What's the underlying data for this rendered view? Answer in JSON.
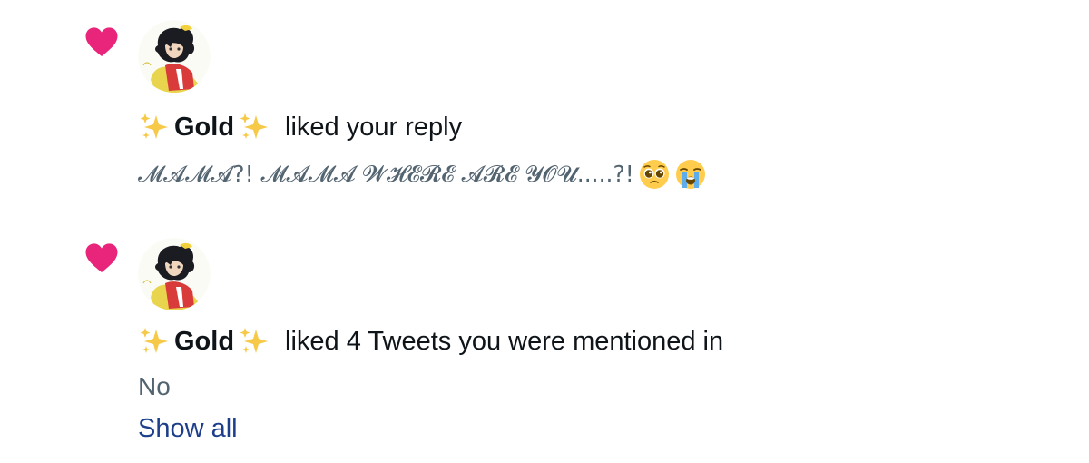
{
  "notifications": [
    {
      "type": "like",
      "icon": "heart-icon",
      "icon_color": "#e8257a",
      "username": "Gold",
      "action": "liked your reply",
      "tweet_text": "𝓜𝓐𝓜𝓐?! 𝓜𝓐𝓜𝓐 𝓦𝓗𝓔𝓡𝓔 𝓐𝓡𝓔 𝓨𝓞𝓤.....?!",
      "emojis": [
        "pleading-face-emoji",
        "loudly-crying-face-emoji"
      ]
    },
    {
      "type": "like",
      "icon": "heart-icon",
      "icon_color": "#e8257a",
      "username": "Gold",
      "action": "liked 4 Tweets you were mentioned in",
      "tweet_text": "No",
      "show_all": "Show all"
    }
  ],
  "colors": {
    "heart": "#e8257a",
    "link": "#1d3e8a",
    "secondary_text": "#536471",
    "divider": "#cfd9de"
  }
}
